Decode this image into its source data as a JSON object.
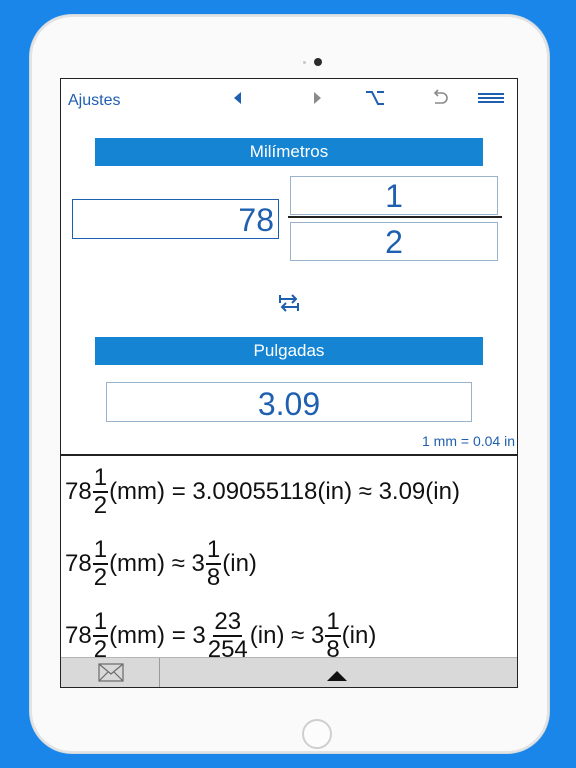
{
  "nav": {
    "settings_label": "Ajustes"
  },
  "converter": {
    "from_unit": "Milímetros",
    "to_unit": "Pulgadas",
    "whole_value": "78",
    "numerator": "1",
    "denominator": "2",
    "result": "3.09",
    "ratio": "1 mm = 0.04 in"
  },
  "results": {
    "row1": {
      "whole": "78",
      "num": "1",
      "den": "2",
      "unit_from": "(mm) = 3.09055118(in) ≈ 3.09(in)"
    },
    "row2": {
      "whole": "78",
      "num": "1",
      "den": "2",
      "mid": "(mm) ≈ 3",
      "num2": "1",
      "den2": "8",
      "tail": "(in)"
    },
    "row3": {
      "whole": "78",
      "num": "1",
      "den": "2",
      "mid": "(mm) = 3",
      "num2": "23",
      "den2": "254",
      "mid2": "(in) ≈ 3",
      "num3": "1",
      "den3": "8",
      "tail": "(in)"
    }
  },
  "colors": {
    "accent": "#1484d3",
    "text_blue": "#1f5fb0",
    "background": "#1a86ea"
  },
  "icons": [
    "back-arrow-icon",
    "forward-arrow-icon",
    "option-key-icon",
    "undo-icon",
    "menu-icon",
    "swap-icon",
    "mail-icon",
    "expand-up-icon"
  ]
}
